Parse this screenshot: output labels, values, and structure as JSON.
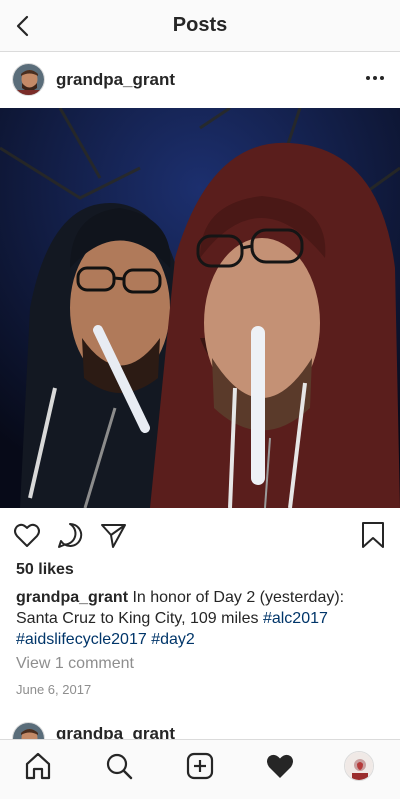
{
  "header": {
    "title": "Posts",
    "back_icon": "chevron-left-icon"
  },
  "post": {
    "username": "grandpa_grant",
    "likes": "50 likes",
    "caption_user": "grandpa_grant",
    "caption_text": "In honor of Day 2 (yesterday): Santa Cruz to King City, 109 miles",
    "hashtags": [
      "#alc2017",
      "#aidslifecycle2017",
      "#day2"
    ],
    "view_comments": "View 1 comment",
    "date": "June 6, 2017"
  },
  "next_post": {
    "username": "grandpa_grant"
  },
  "tabbar": {
    "items": [
      "home-icon",
      "search-icon",
      "add-post-icon",
      "activity-heart-icon",
      "profile-avatar"
    ]
  },
  "colors": {
    "hashtag": "#003569",
    "muted": "#8e8e8e",
    "border": "#dbdbdb",
    "text": "#262626"
  }
}
